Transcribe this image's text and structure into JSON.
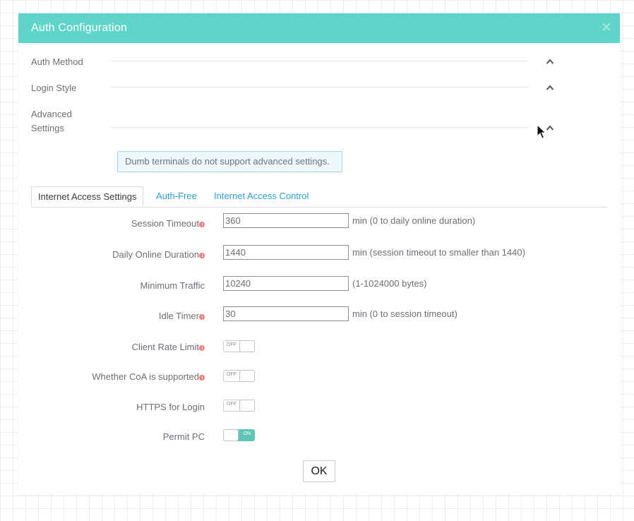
{
  "dialog": {
    "title": "Auth Configuration",
    "close_icon": "close-icon",
    "accent_color": "#5fd4c8"
  },
  "sections": [
    {
      "label": "Auth Method",
      "icon": "chevron-up-icon"
    },
    {
      "label": "Login Style",
      "icon": "chevron-up-icon"
    },
    {
      "label_line1": "Advanced",
      "label_line2": "Settings",
      "icon": "chevron-up-icon"
    }
  ],
  "notice": "Dumb terminals do not support advanced settings.",
  "tabs": [
    {
      "label": "Internet Access Settings",
      "active": true
    },
    {
      "label": "Auth-Free",
      "active": false
    },
    {
      "label": "Internet Access Control",
      "active": false
    }
  ],
  "fields": {
    "session_timeout": {
      "label": "Session Timeout",
      "value": "360",
      "hint": "min (0 to daily online duration)",
      "info_icon": "info-icon"
    },
    "daily_online_duration": {
      "label": "Daily Online Duration",
      "value": "1440",
      "hint": "min (session timeout to smaller than 1440)",
      "info_icon": "info-icon"
    },
    "minimum_traffic": {
      "label": "Minimum Traffic",
      "value": "10240",
      "hint": "(1-1024000 bytes)"
    },
    "idle_timer": {
      "label": "Idle Timer",
      "value": "30",
      "hint": "min (0 to session timeout)",
      "info_icon": "info-icon"
    }
  },
  "toggles": {
    "client_rate_limit": {
      "label": "Client Rate Limit",
      "state": "OFF",
      "info_icon": "info-icon"
    },
    "coa_supported": {
      "label": "Whether CoA is supported",
      "state": "OFF",
      "info_icon": "info-icon"
    },
    "https_login": {
      "label": "HTTPS for Login",
      "state": "OFF"
    },
    "permit_pc": {
      "label": "Permit PC",
      "state": "ON"
    }
  },
  "ok_label": "OK",
  "colors": {
    "toggle_on": "#5fc4b8",
    "link": "#2a9fd6",
    "info": "#f07d7d"
  }
}
